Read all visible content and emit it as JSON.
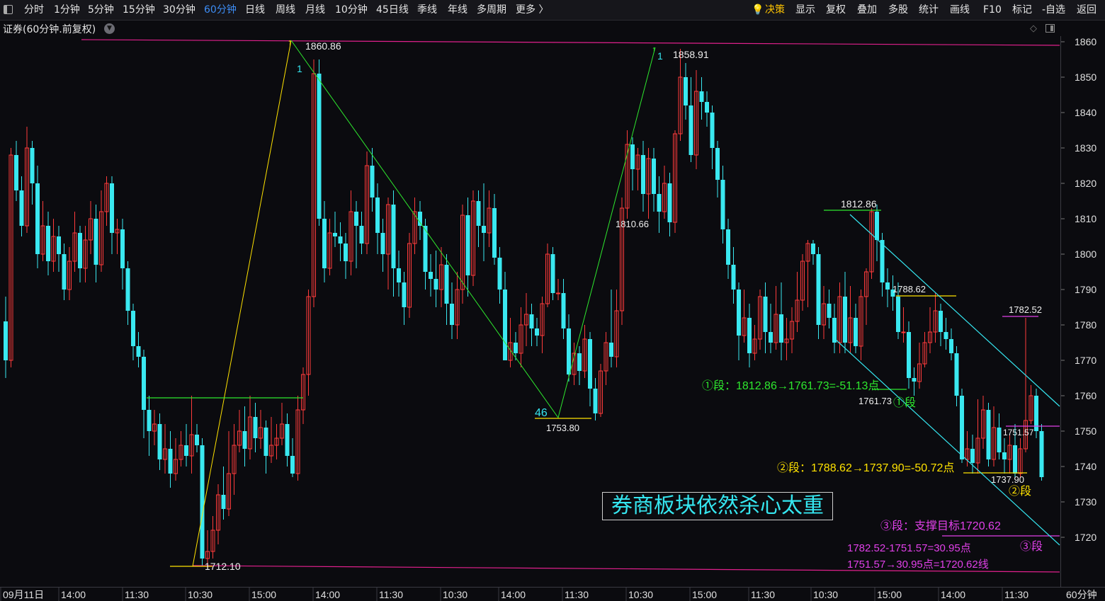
{
  "toolbar": {
    "left": [
      "分时",
      "1分钟",
      "5分钟",
      "15分钟",
      "30分钟",
      "60分钟",
      "日线",
      "周线",
      "月线",
      "10分钟",
      "45日线",
      "季线",
      "年线",
      "多周期",
      "更多 〉"
    ],
    "active": "60分钟",
    "right": [
      "决策",
      "显示",
      "复权",
      "叠加",
      "多股",
      "统计",
      "画线",
      "F10",
      "标记",
      "-自选",
      "返回"
    ],
    "decision_icon": "bulb-icon"
  },
  "title": "证券(60分钟.前复权)",
  "caption": "券商板块依然杀心太重",
  "xaxis_labels": [
    "09月11日",
    "14:00",
    "11:30",
    "10:30",
    "15:00",
    "14:00",
    "11:30",
    "10:30",
    "14:00",
    "11:30",
    "10:30",
    "15:00",
    "11:30",
    "10:30",
    "15:00",
    "14:00",
    "11:30"
  ],
  "period_label": "60分钟",
  "colors": {
    "up": "#ff3b3b",
    "down": "#3ae8f0",
    "magenta": "#e0208c",
    "yellow": "#ffe200",
    "green": "#2ee82e",
    "cyan": "#35e6f0",
    "pink": "#e040e8"
  },
  "chart_data": {
    "type": "candlestick",
    "y_ticks": [
      1860,
      1850,
      1840,
      1830,
      1820,
      1810,
      1800,
      1790,
      1780,
      1770,
      1760,
      1750,
      1740,
      1730,
      1720
    ],
    "ylim": [
      1710,
      1862
    ],
    "price_labels": {
      "high1": "1860.86",
      "high2": "1858.91",
      "low1": "1712.10",
      "low2": "1753.80",
      "mid1": "1810.66",
      "p1812": "1812.86",
      "p1788": "1788.62",
      "p1782": "1782.52",
      "p1761": "1761.73",
      "p1751": "1751.57",
      "p1737": "1737.90"
    },
    "wave_marks": {
      "n1a": "1",
      "n1b": "1",
      "n46": "46"
    },
    "annotations": {
      "seg1": "①段：1812.86→1761.73=-51.13点",
      "seg1_tag": "①段",
      "seg2": "②段：1788.62→1737.90=-50.72点",
      "seg2_tag": "②段",
      "seg3": "③段：支撑目标1720.62",
      "seg3_tag": "③段",
      "calc1": "1782.52-1751.57=30.95点",
      "calc2": "1751.57→30.95点=1720.62线"
    },
    "candles": [
      [
        1781,
        1770,
        1788,
        1765
      ],
      [
        1770,
        1828,
        1830,
        1768
      ],
      [
        1828,
        1818,
        1832,
        1815
      ],
      [
        1818,
        1808,
        1822,
        1805
      ],
      [
        1808,
        1830,
        1836,
        1806
      ],
      [
        1830,
        1820,
        1832,
        1814
      ],
      [
        1820,
        1800,
        1825,
        1796
      ],
      [
        1800,
        1808,
        1815,
        1798
      ],
      [
        1808,
        1798,
        1812,
        1794
      ],
      [
        1798,
        1805,
        1810,
        1795
      ],
      [
        1805,
        1800,
        1808,
        1795
      ],
      [
        1800,
        1790,
        1803,
        1787
      ],
      [
        1790,
        1798,
        1802,
        1787
      ],
      [
        1798,
        1806,
        1812,
        1795
      ],
      [
        1806,
        1796,
        1808,
        1792
      ],
      [
        1796,
        1804,
        1808,
        1792
      ],
      [
        1804,
        1810,
        1815,
        1800
      ],
      [
        1810,
        1797,
        1814,
        1792
      ],
      [
        1797,
        1812,
        1818,
        1795
      ],
      [
        1812,
        1820,
        1822,
        1808
      ],
      [
        1820,
        1806,
        1822,
        1800
      ],
      [
        1806,
        1807,
        1810,
        1800
      ],
      [
        1807,
        1796,
        1810,
        1790
      ],
      [
        1796,
        1784,
        1798,
        1780
      ],
      [
        1784,
        1774,
        1786,
        1770
      ],
      [
        1774,
        1771,
        1778,
        1768
      ],
      [
        1771,
        1756,
        1773,
        1748
      ],
      [
        1756,
        1750,
        1760,
        1743
      ],
      [
        1750,
        1752,
        1756,
        1746
      ],
      [
        1752,
        1742,
        1755,
        1739
      ],
      [
        1742,
        1745,
        1752,
        1738
      ],
      [
        1745,
        1738,
        1750,
        1734
      ],
      [
        1738,
        1742,
        1748,
        1736
      ],
      [
        1742,
        1746,
        1750,
        1740
      ],
      [
        1746,
        1743,
        1752,
        1740
      ],
      [
        1743,
        1749,
        1760,
        1738
      ],
      [
        1749,
        1746,
        1752,
        1744
      ],
      [
        1746,
        1714,
        1748,
        1712
      ],
      [
        1714,
        1716,
        1722,
        1712
      ],
      [
        1716,
        1722,
        1726,
        1714
      ],
      [
        1722,
        1732,
        1735,
        1718
      ],
      [
        1732,
        1728,
        1740,
        1725
      ],
      [
        1728,
        1738,
        1750,
        1726
      ],
      [
        1738,
        1746,
        1752,
        1732
      ],
      [
        1746,
        1750,
        1756,
        1744
      ],
      [
        1750,
        1745,
        1757,
        1740
      ],
      [
        1745,
        1754,
        1760,
        1742
      ],
      [
        1754,
        1748,
        1758,
        1744
      ],
      [
        1748,
        1751,
        1756,
        1745
      ],
      [
        1751,
        1743,
        1753,
        1738
      ],
      [
        1743,
        1746,
        1754,
        1741
      ],
      [
        1746,
        1748,
        1752,
        1742
      ],
      [
        1748,
        1752,
        1758,
        1746
      ],
      [
        1752,
        1743,
        1755,
        1740
      ],
      [
        1743,
        1738,
        1748,
        1737
      ],
      [
        1738,
        1756,
        1760,
        1736
      ],
      [
        1756,
        1766,
        1768,
        1752
      ],
      [
        1766,
        1788,
        1790,
        1760
      ],
      [
        1788,
        1851,
        1855,
        1785
      ],
      [
        1851,
        1810,
        1855,
        1808
      ],
      [
        1810,
        1796,
        1815,
        1792
      ],
      [
        1796,
        1806,
        1810,
        1794
      ],
      [
        1806,
        1805,
        1812,
        1802
      ],
      [
        1805,
        1803,
        1809,
        1798
      ],
      [
        1803,
        1798,
        1806,
        1793
      ],
      [
        1798,
        1812,
        1818,
        1794
      ],
      [
        1812,
        1808,
        1815,
        1796
      ],
      [
        1808,
        1803,
        1812,
        1800
      ],
      [
        1803,
        1825,
        1829,
        1800
      ],
      [
        1825,
        1816,
        1830,
        1812
      ],
      [
        1816,
        1806,
        1820,
        1800
      ],
      [
        1806,
        1800,
        1810,
        1795
      ],
      [
        1800,
        1814,
        1816,
        1790
      ],
      [
        1814,
        1796,
        1818,
        1788
      ],
      [
        1796,
        1792,
        1801,
        1788
      ],
      [
        1792,
        1785,
        1795,
        1780
      ],
      [
        1785,
        1803,
        1806,
        1782
      ],
      [
        1803,
        1812,
        1816,
        1800
      ],
      [
        1812,
        1808,
        1815,
        1804
      ],
      [
        1808,
        1795,
        1810,
        1790
      ],
      [
        1795,
        1793,
        1800,
        1788
      ],
      [
        1793,
        1790,
        1801,
        1785
      ],
      [
        1790,
        1797,
        1802,
        1785
      ],
      [
        1797,
        1786,
        1800,
        1780
      ],
      [
        1786,
        1780,
        1792,
        1776
      ],
      [
        1780,
        1790,
        1795,
        1776
      ],
      [
        1790,
        1811,
        1814,
        1786
      ],
      [
        1811,
        1794,
        1816,
        1788
      ],
      [
        1794,
        1815,
        1818,
        1791
      ],
      [
        1815,
        1808,
        1818,
        1802
      ],
      [
        1808,
        1806,
        1820,
        1798
      ],
      [
        1806,
        1813,
        1818,
        1802
      ],
      [
        1813,
        1799,
        1817,
        1797
      ],
      [
        1799,
        1790,
        1802,
        1786
      ],
      [
        1790,
        1770,
        1795,
        1770
      ],
      [
        1770,
        1775,
        1782,
        1768
      ],
      [
        1775,
        1772,
        1778,
        1770
      ],
      [
        1772,
        1780,
        1785,
        1768
      ],
      [
        1780,
        1783,
        1789,
        1774
      ],
      [
        1783,
        1779,
        1786,
        1774
      ],
      [
        1779,
        1777,
        1782,
        1774
      ],
      [
        1777,
        1786,
        1788,
        1772
      ],
      [
        1786,
        1800,
        1803,
        1785
      ],
      [
        1800,
        1789,
        1802,
        1787
      ],
      [
        1789,
        1789,
        1793,
        1787
      ],
      [
        1789,
        1779,
        1793,
        1776
      ],
      [
        1779,
        1766,
        1783,
        1764
      ],
      [
        1766,
        1772,
        1775,
        1763
      ],
      [
        1772,
        1767,
        1774,
        1763
      ],
      [
        1767,
        1776,
        1780,
        1765
      ],
      [
        1776,
        1762,
        1778,
        1757
      ],
      [
        1762,
        1755,
        1765,
        1753
      ],
      [
        1755,
        1767,
        1769,
        1754
      ],
      [
        1767,
        1775,
        1778,
        1763
      ],
      [
        1775,
        1771,
        1790,
        1768
      ],
      [
        1771,
        1784,
        1790,
        1768
      ],
      [
        1784,
        1813,
        1816,
        1780
      ],
      [
        1813,
        1831,
        1835,
        1810
      ],
      [
        1831,
        1824,
        1833,
        1818
      ],
      [
        1824,
        1828,
        1830,
        1818
      ],
      [
        1828,
        1817,
        1832,
        1812
      ],
      [
        1817,
        1827,
        1830,
        1810
      ],
      [
        1827,
        1817,
        1830,
        1812
      ],
      [
        1817,
        1812,
        1822,
        1806
      ],
      [
        1812,
        1820,
        1825,
        1810
      ],
      [
        1820,
        1809,
        1823,
        1805
      ],
      [
        1809,
        1834,
        1835,
        1806
      ],
      [
        1834,
        1850,
        1858,
        1832
      ],
      [
        1850,
        1842,
        1854,
        1838
      ],
      [
        1842,
        1828,
        1850,
        1826
      ],
      [
        1828,
        1846,
        1852,
        1824
      ],
      [
        1846,
        1843,
        1850,
        1838
      ],
      [
        1843,
        1840,
        1846,
        1836
      ],
      [
        1840,
        1830,
        1842,
        1824
      ],
      [
        1830,
        1821,
        1832,
        1816
      ],
      [
        1821,
        1807,
        1825,
        1803
      ],
      [
        1807,
        1797,
        1810,
        1793
      ],
      [
        1797,
        1790,
        1802,
        1786
      ],
      [
        1790,
        1777,
        1792,
        1770
      ],
      [
        1777,
        1782,
        1790,
        1775
      ],
      [
        1782,
        1772,
        1786,
        1768
      ],
      [
        1772,
        1776,
        1780,
        1770
      ],
      [
        1776,
        1788,
        1790,
        1773
      ],
      [
        1788,
        1778,
        1792,
        1772
      ],
      [
        1778,
        1775,
        1786,
        1772
      ],
      [
        1775,
        1783,
        1791,
        1773
      ],
      [
        1783,
        1775,
        1792,
        1770
      ],
      [
        1775,
        1776,
        1782,
        1770
      ],
      [
        1776,
        1781,
        1785,
        1772
      ],
      [
        1781,
        1787,
        1795,
        1778
      ],
      [
        1787,
        1798,
        1800,
        1784
      ],
      [
        1798,
        1803,
        1804,
        1785
      ],
      [
        1803,
        1800,
        1804,
        1797
      ],
      [
        1800,
        1780,
        1802,
        1776
      ],
      [
        1780,
        1786,
        1791,
        1776
      ],
      [
        1786,
        1782,
        1790,
        1779
      ],
      [
        1782,
        1775,
        1786,
        1772
      ],
      [
        1775,
        1788,
        1792,
        1772
      ],
      [
        1788,
        1775,
        1795,
        1772
      ],
      [
        1775,
        1782,
        1791,
        1772
      ],
      [
        1782,
        1774,
        1786,
        1772
      ],
      [
        1774,
        1788,
        1790,
        1770
      ],
      [
        1788,
        1795,
        1796,
        1780
      ],
      [
        1795,
        1812,
        1813,
        1793
      ],
      [
        1812,
        1804,
        1814,
        1798
      ],
      [
        1804,
        1792,
        1806,
        1788
      ],
      [
        1792,
        1790,
        1796,
        1785
      ],
      [
        1790,
        1788,
        1794,
        1784
      ],
      [
        1788,
        1778,
        1792,
        1776
      ],
      [
        1778,
        1778,
        1785,
        1775
      ],
      [
        1778,
        1765,
        1781,
        1762
      ],
      [
        1765,
        1764,
        1768,
        1760
      ],
      [
        1764,
        1769,
        1775,
        1762
      ],
      [
        1769,
        1775,
        1778,
        1768
      ],
      [
        1775,
        1778,
        1785,
        1772
      ],
      [
        1778,
        1784,
        1789,
        1775
      ],
      [
        1784,
        1778,
        1786,
        1774
      ],
      [
        1778,
        1776,
        1782,
        1773
      ],
      [
        1776,
        1772,
        1779,
        1770
      ],
      [
        1772,
        1760,
        1774,
        1757
      ],
      [
        1760,
        1742,
        1762,
        1741
      ],
      [
        1742,
        1745,
        1750,
        1740
      ],
      [
        1745,
        1741,
        1749,
        1738
      ],
      [
        1741,
        1748,
        1759,
        1738
      ],
      [
        1748,
        1756,
        1760,
        1745
      ],
      [
        1756,
        1742,
        1758,
        1740
      ],
      [
        1742,
        1751,
        1757,
        1740
      ],
      [
        1751,
        1744,
        1755,
        1742
      ],
      [
        1744,
        1742,
        1748,
        1738
      ],
      [
        1742,
        1746,
        1749,
        1738
      ],
      [
        1746,
        1738,
        1752,
        1737
      ],
      [
        1738,
        1745,
        1748,
        1737
      ],
      [
        1745,
        1753,
        1782,
        1744
      ],
      [
        1753,
        1760,
        1763,
        1752
      ],
      [
        1760,
        1750,
        1762,
        1748
      ],
      [
        1750,
        1737,
        1752,
        1736
      ]
    ]
  }
}
